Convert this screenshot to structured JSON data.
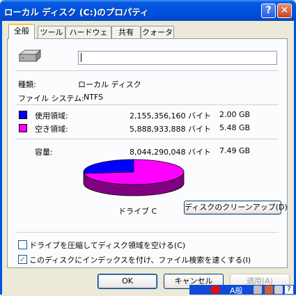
{
  "window": {
    "title": "ローカル ディスク (C:)のプロパティ",
    "help_label": "?",
    "close_label": "✕"
  },
  "tabs": [
    {
      "label": "全般",
      "active": true
    },
    {
      "label": "ツール"
    },
    {
      "label": "ハードウェア"
    },
    {
      "label": "共有"
    },
    {
      "label": "クォータ"
    }
  ],
  "general": {
    "name_value": "",
    "type_label": "種類:",
    "type_value": "ローカル ディスク",
    "fs_label": "ファイル システム:",
    "fs_value": "NTFS",
    "used_label": "使用領域:",
    "used_bytes": "2,155,356,160 バイト",
    "used_gb": "2.00 GB",
    "free_label": "空き領域:",
    "free_bytes": "5,888,933,888 バイト",
    "free_gb": "5.48 GB",
    "capacity_label": "容量:",
    "capacity_bytes": "8,044,290,048 バイト",
    "capacity_gb": "7.49 GB",
    "drive_label": "ドライブ C",
    "cleanup_button": "ディスクのクリーンアップ(D)",
    "compress_label": "ドライブを圧縮してディスク領域を空ける(C)",
    "compress_checked": false,
    "index_label": "このディスクにインデックスを付け、ファイル検索を速くする(I)",
    "index_checked": true
  },
  "colors": {
    "used": "#0000FF",
    "free": "#FF00FF"
  },
  "chart_data": {
    "type": "pie",
    "categories": [
      "使用領域",
      "空き領域"
    ],
    "values": [
      2155356160,
      5888933888
    ]
  },
  "buttons": {
    "ok": "OK",
    "cancel": "キャンセル",
    "apply": "適用(A)"
  },
  "taskbar": {
    "ime_label": "A般"
  }
}
